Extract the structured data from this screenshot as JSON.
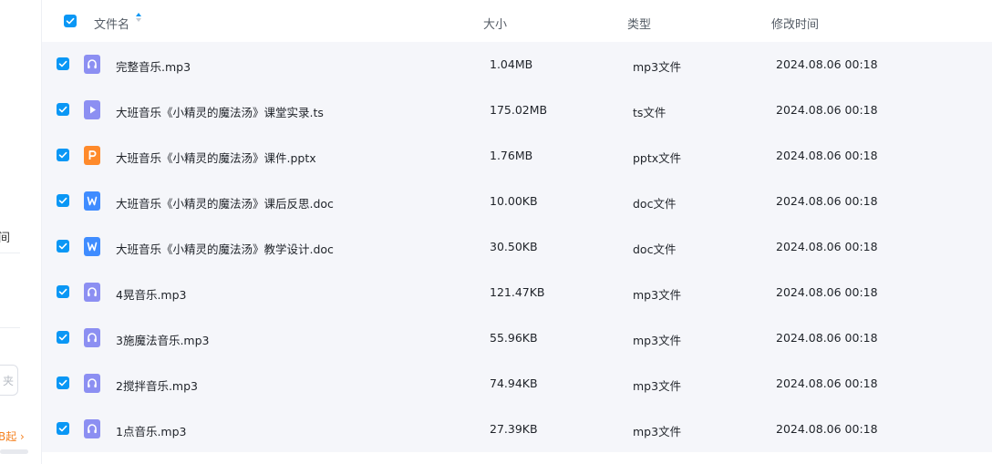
{
  "sidebar": {
    "fragment_text": "间",
    "box_text": "夹",
    "upgrade_text": "B起 ›"
  },
  "header": {
    "name_label": "文件名",
    "size_label": "大小",
    "type_label": "类型",
    "modified_label": "修改时间"
  },
  "colors": {
    "accent": "#0a97f5",
    "audio_icon": "#8c8ff2",
    "video_icon": "#8c8ff2",
    "pptx_icon": "#ff8a2b",
    "doc_icon": "#3f8cff"
  },
  "files": [
    {
      "icon": "audio-file-icon",
      "name": "完整音乐.mp3",
      "size": "1.04MB",
      "type": "mp3文件",
      "modified": "2024.08.06 00:18"
    },
    {
      "icon": "video-file-icon",
      "name": "大班音乐《小精灵的魔法汤》课堂实录.ts",
      "size": "175.02MB",
      "type": "ts文件",
      "modified": "2024.08.06 00:18"
    },
    {
      "icon": "pptx-file-icon",
      "name": "大班音乐《小精灵的魔法汤》课件.pptx",
      "size": "1.76MB",
      "type": "pptx文件",
      "modified": "2024.08.06 00:18"
    },
    {
      "icon": "word-file-icon",
      "name": "大班音乐《小精灵的魔法汤》课后反思.doc",
      "size": "10.00KB",
      "type": "doc文件",
      "modified": "2024.08.06 00:18"
    },
    {
      "icon": "word-file-icon",
      "name": "大班音乐《小精灵的魔法汤》教学设计.doc",
      "size": "30.50KB",
      "type": "doc文件",
      "modified": "2024.08.06 00:18"
    },
    {
      "icon": "audio-file-icon",
      "name": "4晃音乐.mp3",
      "size": "121.47KB",
      "type": "mp3文件",
      "modified": "2024.08.06 00:18"
    },
    {
      "icon": "audio-file-icon",
      "name": "3施魔法音乐.mp3",
      "size": "55.96KB",
      "type": "mp3文件",
      "modified": "2024.08.06 00:18"
    },
    {
      "icon": "audio-file-icon",
      "name": "2搅拌音乐.mp3",
      "size": "74.94KB",
      "type": "mp3文件",
      "modified": "2024.08.06 00:18"
    },
    {
      "icon": "audio-file-icon",
      "name": "1点音乐.mp3",
      "size": "27.39KB",
      "type": "mp3文件",
      "modified": "2024.08.06 00:18"
    }
  ]
}
